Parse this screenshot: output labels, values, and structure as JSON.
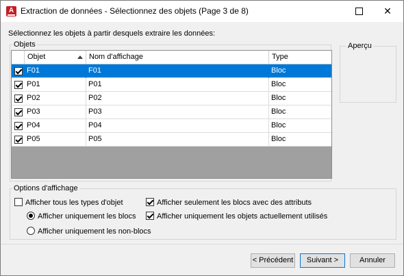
{
  "window": {
    "title": "Extraction de données - Sélectionnez des objets (Page 3 de 8)",
    "app_icon_letter": "A"
  },
  "instruction": "Sélectionnez les objets à partir desquels extraire les données:",
  "objects_group": {
    "title": "Objets",
    "columns": [
      "Objet",
      "Nom d'affichage",
      "Type"
    ],
    "rows": [
      {
        "checked": true,
        "object": "F01",
        "display_name": "F01",
        "type": "Bloc",
        "selected": true
      },
      {
        "checked": true,
        "object": "P01",
        "display_name": "P01",
        "type": "Bloc",
        "selected": false
      },
      {
        "checked": true,
        "object": "P02",
        "display_name": "P02",
        "type": "Bloc",
        "selected": false
      },
      {
        "checked": true,
        "object": "P03",
        "display_name": "P03",
        "type": "Bloc",
        "selected": false
      },
      {
        "checked": true,
        "object": "P04",
        "display_name": "P04",
        "type": "Bloc",
        "selected": false
      },
      {
        "checked": true,
        "object": "P05",
        "display_name": "P05",
        "type": "Bloc",
        "selected": false
      }
    ]
  },
  "preview": {
    "title": "Aperçu"
  },
  "display_options": {
    "title": "Options d'affichage",
    "show_all_types": {
      "label": "Afficher tous les types d'objet",
      "checked": false
    },
    "show_blocks_only": {
      "label": "Afficher uniquement les blocs",
      "selected": true
    },
    "show_nonblocks_only": {
      "label": "Afficher uniquement les non-blocs",
      "selected": false
    },
    "show_blocks_with_attrs": {
      "label": "Afficher seulement les  blocs avec des attributs",
      "checked": true
    },
    "show_in_use_only": {
      "label": "Afficher uniquement les objets actuellement utilisés",
      "checked": true
    }
  },
  "buttons": {
    "previous": "< Précédent",
    "next": "Suivant >",
    "cancel": "Annuler"
  },
  "colors": {
    "selection": "#0078d7",
    "table_empty": "#a0a0a0"
  }
}
